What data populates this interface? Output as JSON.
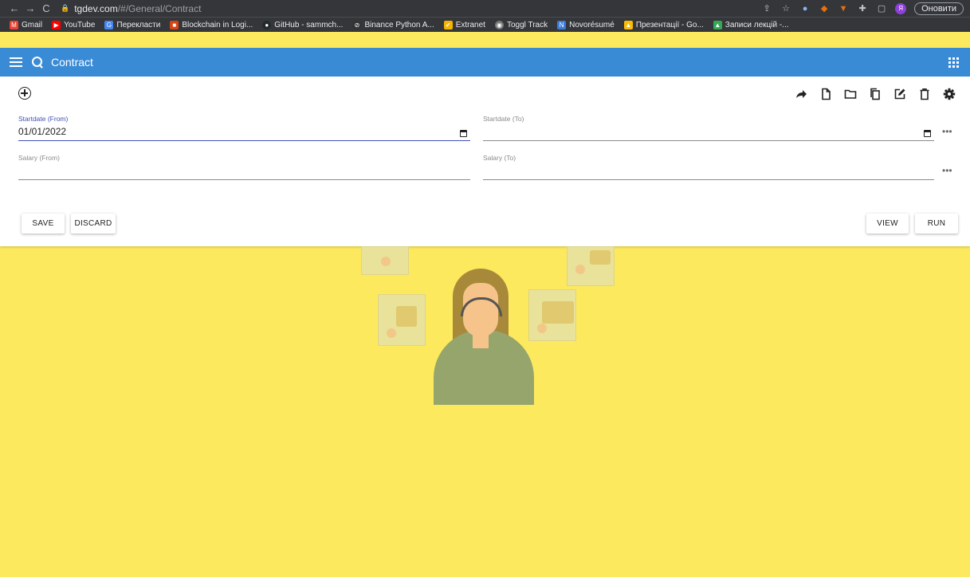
{
  "browser": {
    "url_host": "tgdev.com",
    "url_path": "/#/General/Contract",
    "update_label": "Оновити",
    "profile_initial": "Я"
  },
  "bookmarks": [
    {
      "label": "Gmail",
      "color": "#ea4335",
      "icon": "M"
    },
    {
      "label": "YouTube",
      "color": "#ff0000",
      "icon": "▶"
    },
    {
      "label": "Перекласти",
      "color": "#4285f4",
      "icon": "G"
    },
    {
      "label": "Blockchain in Logi...",
      "color": "#d84315",
      "icon": "■"
    },
    {
      "label": "GitHub - sammch...",
      "color": "#24292e",
      "icon": "●"
    },
    {
      "label": "Binance Python A...",
      "color": "#333333",
      "icon": "⊘"
    },
    {
      "label": "Extranet",
      "color": "#f4b400",
      "icon": "✔"
    },
    {
      "label": "Toggl Track",
      "color": "#777777",
      "icon": "◉"
    },
    {
      "label": "Novorésumé",
      "color": "#3d7bd8",
      "icon": "N"
    },
    {
      "label": "Презентації - Go...",
      "color": "#fbbc04",
      "icon": "▲"
    },
    {
      "label": "Записи лекцій -...",
      "color": "#34a853",
      "icon": "▲"
    }
  ],
  "app": {
    "title": "Contract",
    "accent": "#3a8bd6",
    "background": "#fce95e"
  },
  "form": {
    "startdate_from_label": "Startdate (From)",
    "startdate_from_value": "01/01/2022",
    "startdate_to_label": "Startdate (To)",
    "startdate_to_value": "",
    "salary_from_label": "Salary (From)",
    "salary_from_value": "",
    "salary_to_label": "Salary (To)",
    "salary_to_value": "",
    "more_glyph": "•••"
  },
  "buttons": {
    "save": "SAVE",
    "discard": "DISCARD",
    "view": "VIEW",
    "run": "RUN"
  },
  "toolbar_icons": [
    "share-icon",
    "new-file-icon",
    "folder-icon",
    "copy-icon",
    "edit-icon",
    "delete-icon",
    "settings-icon"
  ]
}
